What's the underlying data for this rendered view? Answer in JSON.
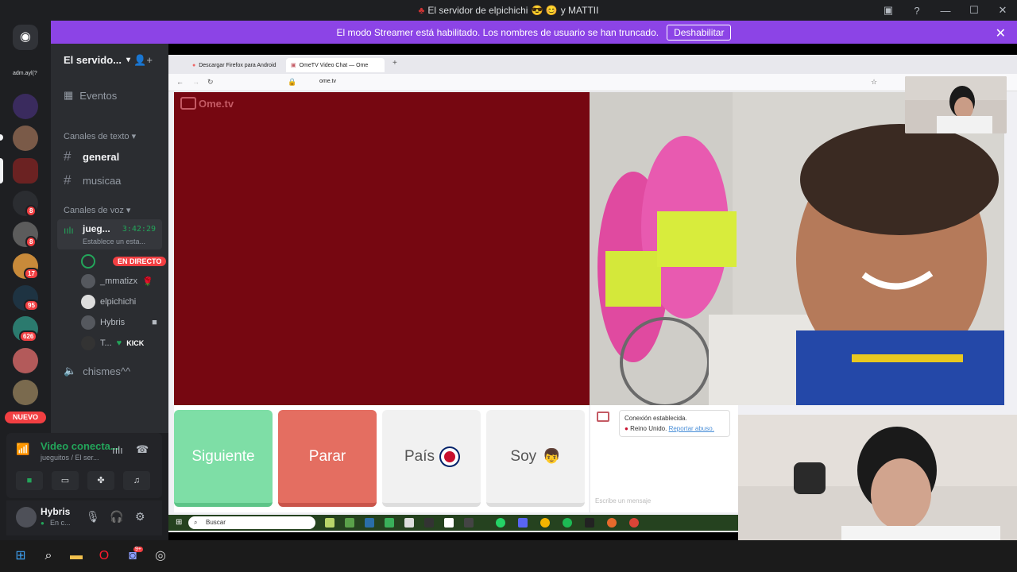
{
  "window": {
    "title": "El servidor de elpichichi",
    "title_suffix": "y MATTII"
  },
  "banner": {
    "message": "El modo Streamer está habilitado. Los nombres de usuario se han truncado.",
    "button": "Deshabilitar"
  },
  "servers": {
    "top_label": "adm.ayl(?",
    "badges": [
      "8",
      "8",
      "17",
      "95",
      "626"
    ],
    "new_label": "NUEVO"
  },
  "sidebar": {
    "server_name": "El servido...",
    "events": "Eventos",
    "text_category": "Canales de texto",
    "text_channels": [
      "general",
      "musicaa"
    ],
    "voice_category": "Canales de voz",
    "voice_channel": {
      "name": "jueg...",
      "timer": "3:42:29",
      "status": "Establece un esta..."
    },
    "voice_users": [
      {
        "name": "",
        "badge": "EN DIRECTO"
      },
      {
        "name": "_mmatizx",
        "badge": ""
      },
      {
        "name": "elpichichi",
        "badge": ""
      },
      {
        "name": "Hybris",
        "badge": ""
      },
      {
        "name": "T...",
        "badge": "KICK"
      }
    ],
    "voice_channel_2": "chismes^^"
  },
  "voice_panel": {
    "title": "Video conecta...",
    "subtitle": "jueguitos / El ser..."
  },
  "user_panel": {
    "name": "Hybris",
    "status": "En c..."
  },
  "browser": {
    "tab1": "Descargar Firefox para Android",
    "tab2": "OmeTV Video Chat — Ome",
    "url": "ome.tv"
  },
  "ometv": {
    "logo": "Ome.tv",
    "btn_next": "Siguiente",
    "btn_stop": "Parar",
    "btn_country": "País",
    "btn_soy": "Soy",
    "chat_connected": "Conexión establecida.",
    "chat_country": "Reino Unido.",
    "chat_report": "Reportar abuso.",
    "chat_placeholder": "Escribe un mensaje"
  },
  "inner_taskbar": {
    "search": "Buscar"
  },
  "taskbar": {
    "discord_badge": "9+"
  },
  "colors": {
    "streamer_banner": "#8c44e6",
    "ome_red": "#760711",
    "next_green": "#7edea6",
    "stop_red": "#e46e61",
    "discord_green": "#23a55a"
  }
}
